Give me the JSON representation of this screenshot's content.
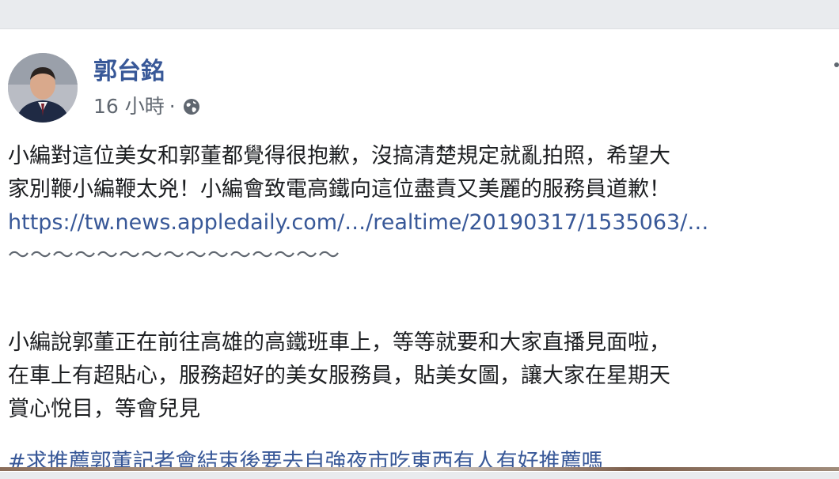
{
  "post": {
    "author": "郭台銘",
    "timestamp": "16 小時",
    "separator": "·",
    "audience_icon": "globe-icon",
    "paragraph1": [
      "小編對這位美女和郭董都覺得很抱歉，沒搞清楚規定就亂拍照，希望大",
      "家別鞭小編鞭太兇！小編會致電高鐵向這位盡責又美麗的服務員道歉！"
    ],
    "link": "https://tw.news.appledaily.com/…/realtime/20190317/1535063/…",
    "tilde_divider": "〜〜〜〜〜〜〜〜〜〜〜〜〜〜〜",
    "paragraph2": [
      "小編說郭董正在前往高雄的高鐵班車上，等等就要和大家直播見面啦，",
      "在車上有超貼心，服務超好的美女服務員，貼美女圖，讓大家在星期天",
      "賞心悅目，等會兒見"
    ],
    "hashtag": "#求推薦郭董記者會結束後要去自強夜市吃東西有人有好推薦嗎"
  },
  "colors": {
    "link": "#385898",
    "text": "#1c1e21",
    "meta": "#606770",
    "background": "#e9ebee"
  }
}
